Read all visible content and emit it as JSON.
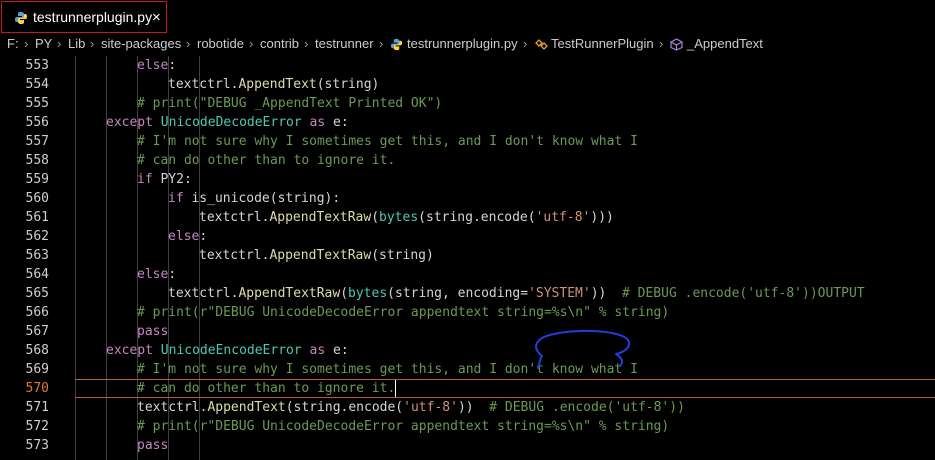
{
  "tab": {
    "filename": "testrunnerplugin.py",
    "close": "×",
    "icon": "python-icon"
  },
  "breadcrumb": [
    {
      "label": "F:",
      "icon": null
    },
    {
      "label": "PY",
      "icon": null
    },
    {
      "label": "Lib",
      "icon": null
    },
    {
      "label": "site-packages",
      "icon": null
    },
    {
      "label": "robotide",
      "icon": null
    },
    {
      "label": "contrib",
      "icon": null
    },
    {
      "label": "testrunner",
      "icon": null
    },
    {
      "label": "testrunnerplugin.py",
      "icon": "python-icon"
    },
    {
      "label": "TestRunnerPlugin",
      "icon": "class-icon"
    },
    {
      "label": "_AppendText",
      "icon": "method-icon"
    }
  ],
  "breadcrumb_separator": "›",
  "current_line": "570",
  "lines": [
    {
      "n": "553",
      "indent": 3,
      "tokens": [
        [
          "kw",
          "else"
        ],
        [
          "p",
          ":"
        ]
      ]
    },
    {
      "n": "554",
      "indent": 4,
      "tokens": [
        [
          "p",
          "textctrl."
        ],
        [
          "fn",
          "AppendText"
        ],
        [
          "p",
          "(string)"
        ]
      ]
    },
    {
      "n": "555",
      "indent": 3,
      "tokens": [
        [
          "cmt",
          "# print(\"DEBUG _AppendText Printed OK\")"
        ]
      ]
    },
    {
      "n": "556",
      "indent": 2,
      "tokens": [
        [
          "kw",
          "except "
        ],
        [
          "cls",
          "UnicodeDecodeError"
        ],
        [
          "kw",
          " as "
        ],
        [
          "p",
          "e:"
        ]
      ]
    },
    {
      "n": "557",
      "indent": 3,
      "tokens": [
        [
          "cmt",
          "# I'm not sure why I sometimes get this, and I don't know what I"
        ]
      ]
    },
    {
      "n": "558",
      "indent": 3,
      "tokens": [
        [
          "cmt",
          "# can do other than to ignore it."
        ]
      ]
    },
    {
      "n": "559",
      "indent": 3,
      "tokens": [
        [
          "kw",
          "if "
        ],
        [
          "p",
          "PY2:"
        ]
      ]
    },
    {
      "n": "560",
      "indent": 4,
      "tokens": [
        [
          "kw",
          "if "
        ],
        [
          "p",
          "is_unicode(string):"
        ]
      ]
    },
    {
      "n": "561",
      "indent": 5,
      "tokens": [
        [
          "p",
          "textctrl."
        ],
        [
          "fn",
          "AppendTextRaw"
        ],
        [
          "p",
          "("
        ],
        [
          "cls",
          "bytes"
        ],
        [
          "p",
          "(string.encode("
        ],
        [
          "str",
          "'utf-8'"
        ],
        [
          "p",
          ")))"
        ]
      ]
    },
    {
      "n": "562",
      "indent": 4,
      "tokens": [
        [
          "kw",
          "else"
        ],
        [
          "p",
          ":"
        ]
      ]
    },
    {
      "n": "563",
      "indent": 5,
      "tokens": [
        [
          "p",
          "textctrl."
        ],
        [
          "fn",
          "AppendTextRaw"
        ],
        [
          "p",
          "(string)"
        ]
      ]
    },
    {
      "n": "564",
      "indent": 3,
      "tokens": [
        [
          "kw",
          "else"
        ],
        [
          "p",
          ":"
        ]
      ]
    },
    {
      "n": "565",
      "indent": 4,
      "tokens": [
        [
          "p",
          "textctrl."
        ],
        [
          "fn",
          "AppendTextRaw"
        ],
        [
          "p",
          "("
        ],
        [
          "cls",
          "bytes"
        ],
        [
          "p",
          "(string, encoding="
        ],
        [
          "str",
          "'SYSTEM'"
        ],
        [
          "p",
          "))  "
        ],
        [
          "cmt",
          "# DEBUG .encode('utf-8'))OUTPUT"
        ]
      ]
    },
    {
      "n": "566",
      "indent": 3,
      "tokens": [
        [
          "cmt",
          "# print(r\"DEBUG UnicodeDecodeError appendtext string=%s\\n\" % string)"
        ]
      ]
    },
    {
      "n": "567",
      "indent": 3,
      "tokens": [
        [
          "kw",
          "pass"
        ]
      ]
    },
    {
      "n": "568",
      "indent": 2,
      "tokens": [
        [
          "kw",
          "except "
        ],
        [
          "cls",
          "UnicodeEncodeError"
        ],
        [
          "kw",
          " as "
        ],
        [
          "p",
          "e:"
        ]
      ]
    },
    {
      "n": "569",
      "indent": 3,
      "tokens": [
        [
          "cmt",
          "# I'm not sure why I sometimes get this, and I don't know what I"
        ]
      ]
    },
    {
      "n": "570",
      "indent": 3,
      "tokens": [
        [
          "cmt",
          "# can do other than to ignore it."
        ]
      ]
    },
    {
      "n": "571",
      "indent": 3,
      "tokens": [
        [
          "p",
          "textctrl."
        ],
        [
          "fn",
          "AppendText"
        ],
        [
          "p",
          "(string.encode("
        ],
        [
          "str",
          "'utf-8'"
        ],
        [
          "p",
          "))  "
        ],
        [
          "cmt",
          "# DEBUG .encode('utf-8'))"
        ]
      ]
    },
    {
      "n": "572",
      "indent": 3,
      "tokens": [
        [
          "cmt",
          "# print(r\"DEBUG UnicodeDecodeError appendtext string=%s\\n\" % string)"
        ]
      ]
    },
    {
      "n": "573",
      "indent": 3,
      "tokens": [
        [
          "kw",
          "pass"
        ]
      ]
    }
  ],
  "colors": {
    "keyword": "#c586c0",
    "function": "#dcdcaa",
    "class": "#4ec9b0",
    "string": "#ce9178",
    "comment": "#6a9955",
    "current_line_number": "#e07a2b",
    "annotation": "#1f3fd8"
  }
}
